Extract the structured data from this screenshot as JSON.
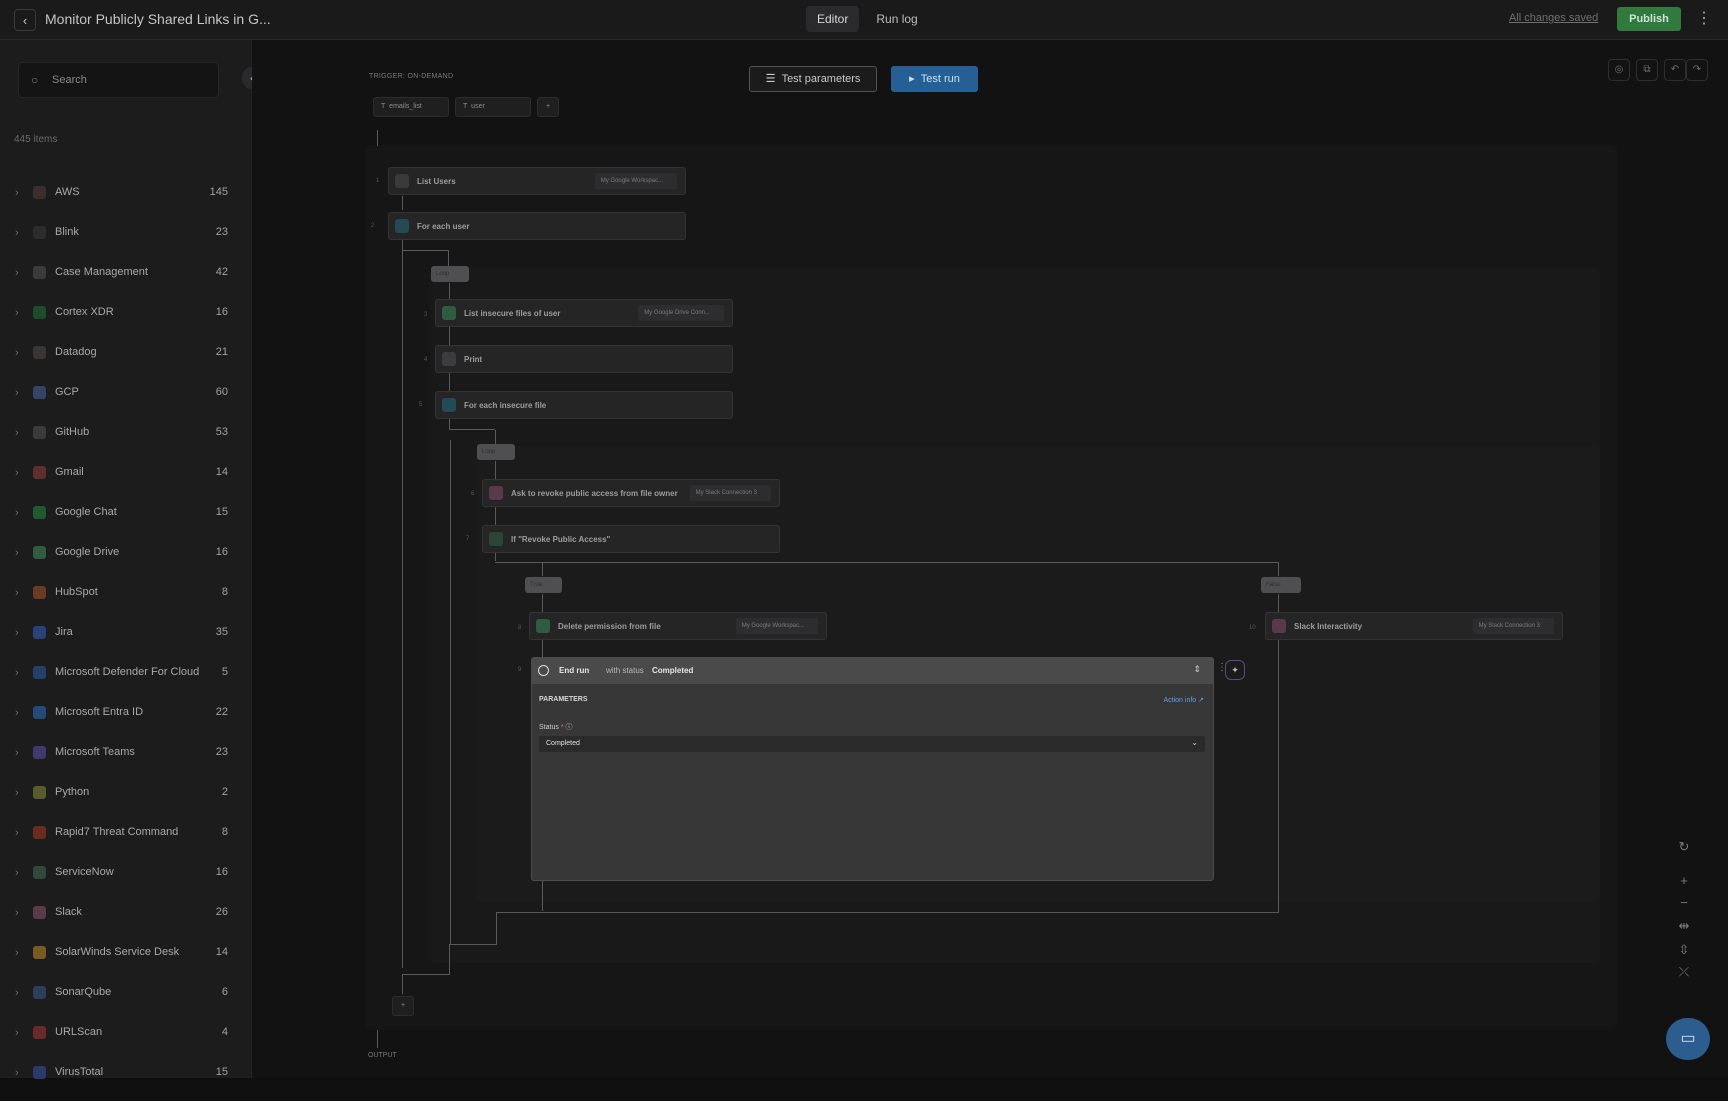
{
  "header": {
    "back_icon": "chevron-left-icon",
    "title": "Monitor Publicly Shared Links in G...",
    "tabs": [
      {
        "label": "Editor",
        "active": true
      },
      {
        "label": "Run log",
        "active": false
      }
    ],
    "saved_status": "All changes saved",
    "publish_label": "Publish",
    "publish_color": "#2f7a3c"
  },
  "sidebar": {
    "search_placeholder": "Search",
    "item_count": "445 items",
    "items": [
      {
        "label": "AWS",
        "count": "145",
        "color": "#3a2f2a"
      },
      {
        "label": "Blink",
        "count": "23",
        "color": "#2c2c2c"
      },
      {
        "label": "Case Management",
        "count": "42",
        "color": "#3a3a3a"
      },
      {
        "label": "Cortex XDR",
        "count": "16",
        "color": "#1c4d2a"
      },
      {
        "label": "Datadog",
        "count": "21",
        "color": "#3a3434"
      },
      {
        "label": "GCP",
        "count": "60",
        "color": "#344466"
      },
      {
        "label": "GitHub",
        "count": "53",
        "color": "#3a3a3a"
      },
      {
        "label": "Gmail",
        "count": "14",
        "color": "#5e2f2b"
      },
      {
        "label": "Google Chat",
        "count": "15",
        "color": "#1f5a2e"
      },
      {
        "label": "Google Drive",
        "count": "16",
        "color": "#2f5b40"
      },
      {
        "label": "HubSpot",
        "count": "8",
        "color": "#6b3a23"
      },
      {
        "label": "Jira",
        "count": "35",
        "color": "#27437a"
      },
      {
        "label": "Microsoft Defender For Cloud",
        "count": "5",
        "color": "#24406a"
      },
      {
        "label": "Microsoft Entra ID",
        "count": "22",
        "color": "#244a7a"
      },
      {
        "label": "Microsoft Teams",
        "count": "23",
        "color": "#3d3a6d"
      },
      {
        "label": "Python",
        "count": "2",
        "color": "#5b5a2a"
      },
      {
        "label": "Rapid7 Threat Command",
        "count": "8",
        "color": "#6a2d1d"
      },
      {
        "label": "ServiceNow",
        "count": "16",
        "color": "#2f4a3a"
      },
      {
        "label": "Slack",
        "count": "26",
        "color": "#5a3a4a"
      },
      {
        "label": "SolarWinds Service Desk",
        "count": "14",
        "color": "#7a5a1f"
      },
      {
        "label": "SonarQube",
        "count": "6",
        "color": "#2b3f5a"
      },
      {
        "label": "URLScan",
        "count": "4",
        "color": "#6a2a2a"
      },
      {
        "label": "VirusTotal",
        "count": "15",
        "color": "#2a3a6a"
      }
    ]
  },
  "canvas": {
    "trigger_label": "TRIGGER: ON-DEMAND",
    "trigger_params": [
      "emails_list",
      "user"
    ],
    "add_symbol": "+",
    "test_parameters_label": "Test parameters",
    "test_run_label": "Test run",
    "test_run_color": "#255f96",
    "output_label": "OUTPUT",
    "steps": {
      "list_users": {
        "label": "List Users",
        "conn": "My Google Workspac...",
        "no": "1"
      },
      "for_each_user": {
        "label": "For each user",
        "no": "2"
      },
      "loop_1": "Loop",
      "list_insecure": {
        "label": "List insecure files of user",
        "conn": "My Google Drive Conn...",
        "no": "3"
      },
      "print": {
        "label": "Print",
        "no": "4"
      },
      "for_each_file": {
        "label": "For each insecure file",
        "no": "5"
      },
      "loop_2": "Loop",
      "ask_revoke": {
        "label": "Ask to revoke public access from file owner",
        "conn": "My Slack Connection 3",
        "no": "6"
      },
      "if_revoke": {
        "label": "If \"Revoke Public Access\"",
        "no": "7"
      },
      "branch_true": "True",
      "branch_false": "False",
      "delete_perm": {
        "label": "Delete permission from file",
        "conn": "My Google Workspac...",
        "no": "8"
      },
      "end_run_no": "9",
      "slack_interactivity": {
        "label": "Slack Interactivity",
        "conn": "My Slack Connection 3",
        "no": "10"
      }
    },
    "end_run": {
      "title_bold": "End run",
      "title_mid": "with status",
      "title_status": "Completed",
      "parameters_label": "PARAMETERS",
      "action_info": "Action info",
      "status_label": "Status",
      "status_required": "*",
      "status_value": "Completed"
    }
  }
}
